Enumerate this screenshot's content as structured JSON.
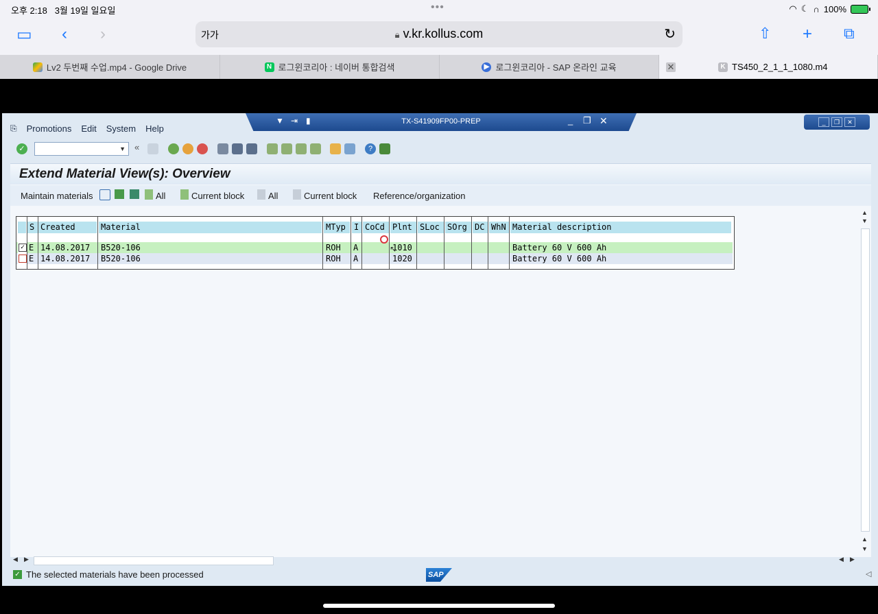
{
  "status": {
    "time": "오후 2:18",
    "date": "3월 19일 일요일",
    "battery": "100%"
  },
  "safari": {
    "text_size": "가가",
    "url": "v.kr.kollus.com"
  },
  "tabs": [
    {
      "label": "Lv2 두번째 수업.mp4 - Google Drive"
    },
    {
      "label": "로그윈코리아 : 네이버 통합검색"
    },
    {
      "label": "로그윈코리아 - SAP 온라인 교육"
    },
    {
      "label": "TS450_2_1_1_1080.m4"
    }
  ],
  "sap": {
    "window_title": "TX-S41909FP00-PREP",
    "menu": [
      "Promotions",
      "Edit",
      "System",
      "Help"
    ],
    "page_title": "Extend Material View(s): Overview",
    "app_toolbar": {
      "maintain": "Maintain materials",
      "all1": "All",
      "current_block1": "Current block",
      "all2": "All",
      "current_block2": "Current block",
      "reference": "Reference/organization"
    },
    "grid": {
      "columns": [
        "S",
        "Created",
        "Material",
        "MTyp",
        "I",
        "CoCd",
        "Plnt",
        "SLoc",
        "SOrg",
        "DC",
        "WhN",
        "Material description"
      ],
      "rows": [
        {
          "checked": true,
          "s": "E",
          "created": "14.08.2017",
          "material": "B520-106",
          "mtyp": "ROH",
          "i": "A",
          "cocd": "",
          "plnt": "1010",
          "sloc": "",
          "sorg": "",
          "dc": "",
          "whn": "",
          "desc": "Battery 60 V 600 Ah"
        },
        {
          "checked": false,
          "s": "E",
          "created": "14.08.2017",
          "material": "B520-106",
          "mtyp": "ROH",
          "i": "A",
          "cocd": "",
          "plnt": "1020",
          "sloc": "",
          "sorg": "",
          "dc": "",
          "whn": "",
          "desc": "Battery 60 V 600 Ah"
        }
      ]
    },
    "status_message": "The selected materials have been processed",
    "logo": "SAP"
  }
}
